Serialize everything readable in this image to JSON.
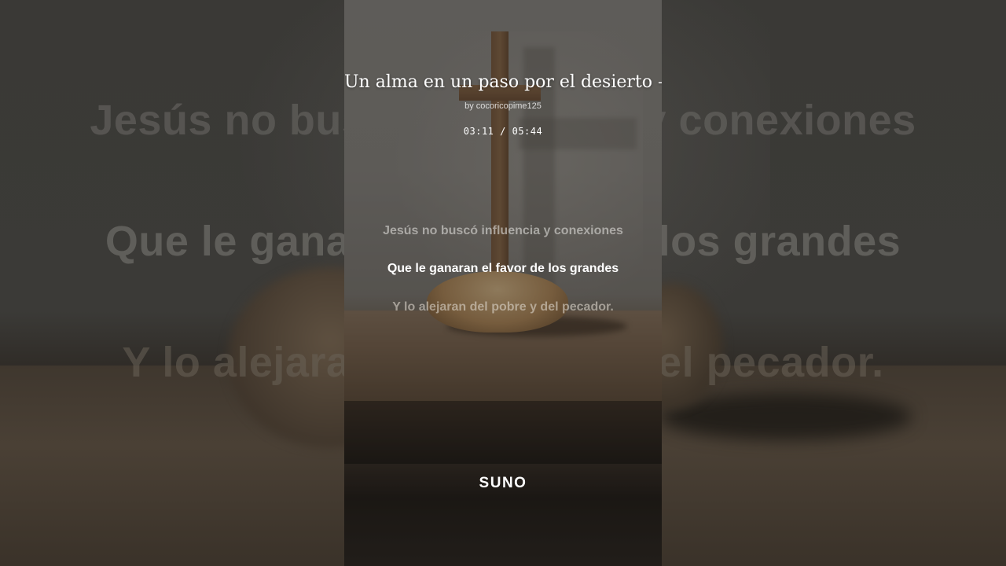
{
  "background_lyrics": [
    "Jesús no buscó influencia y conexiones",
    "Que le ganaran el favor de los grandes",
    "Y lo alejaran del pobre y del pecador."
  ],
  "player": {
    "title": "Un alma en un paso por el desierto – Padre Pim",
    "byline": "by cocoricopime125",
    "current_time": "03:11",
    "separator": "/",
    "total_time": "05:44"
  },
  "lyrics": {
    "previous": "Jesús no buscó influencia y conexiones",
    "current": "Que le ganaran el favor de los grandes",
    "next": "Y lo alejaran del pobre y del pecador."
  },
  "brand": {
    "logo_text": "SUNO"
  },
  "colors": {
    "background": "#1c1b19",
    "text_primary": "#ffffff"
  }
}
